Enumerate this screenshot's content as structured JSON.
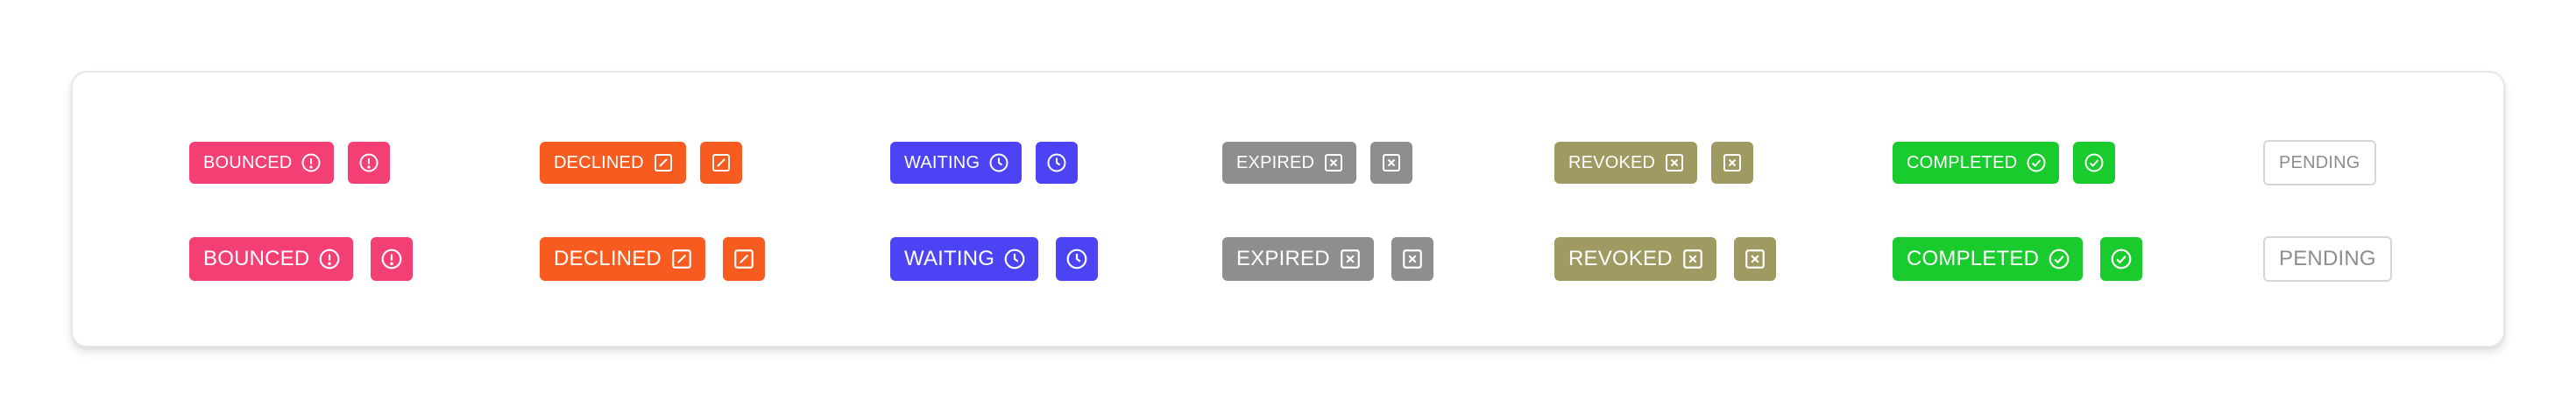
{
  "statuses": [
    {
      "key": "bounced",
      "label": "BOUNCED",
      "icon": "exclamation-circle-icon",
      "color": "#f43f74"
    },
    {
      "key": "declined",
      "label": "DECLINED",
      "icon": "pencil-square-icon",
      "color": "#f75b1f"
    },
    {
      "key": "waiting",
      "label": "WAITING",
      "icon": "clock-icon",
      "color": "#4c44f4"
    },
    {
      "key": "expired",
      "label": "EXPIRED",
      "icon": "x-square-icon",
      "color": "#8e8e8e"
    },
    {
      "key": "revoked",
      "label": "REVOKED",
      "icon": "x-square-icon",
      "color": "#9e9a61"
    },
    {
      "key": "completed",
      "label": "COMPLETED",
      "icon": "check-circle-icon",
      "color": "#19cb2c"
    },
    {
      "key": "pending",
      "label": "PENDING",
      "icon": null,
      "color": "#8d8d8d"
    }
  ]
}
